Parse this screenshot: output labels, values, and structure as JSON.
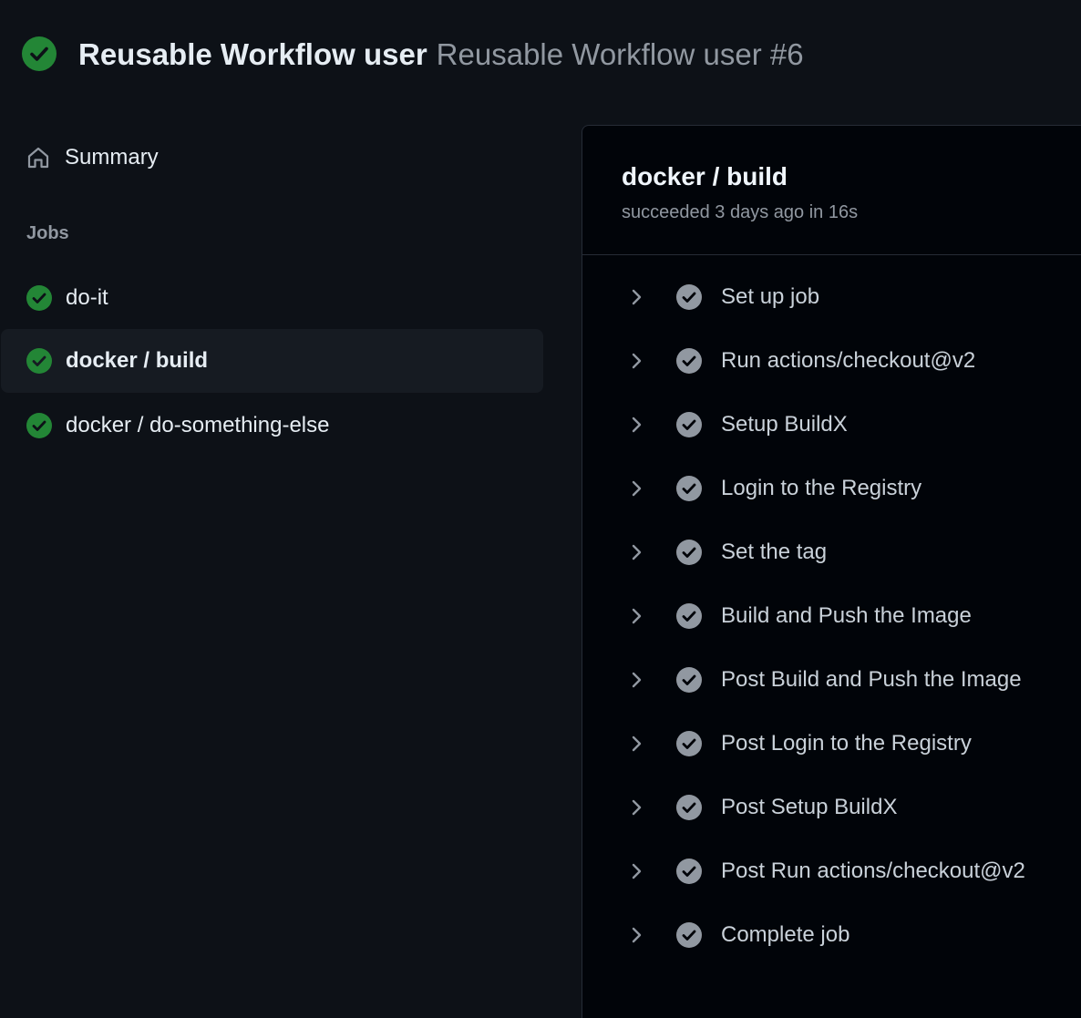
{
  "header": {
    "workflow_name": "Reusable Workflow user",
    "run_title": "Reusable Workflow user #6",
    "status": "success"
  },
  "sidebar": {
    "summary_label": "Summary",
    "jobs_heading": "Jobs",
    "jobs": [
      {
        "label": "do-it",
        "status": "success",
        "selected": false
      },
      {
        "label": "docker / build",
        "status": "success",
        "selected": true
      },
      {
        "label": "docker / do-something-else",
        "status": "success",
        "selected": false
      }
    ]
  },
  "job_panel": {
    "title": "docker / build",
    "meta": "succeeded 3 days ago in 16s",
    "steps": [
      {
        "label": "Set up job"
      },
      {
        "label": "Run actions/checkout@v2"
      },
      {
        "label": "Setup BuildX"
      },
      {
        "label": "Login to the Registry"
      },
      {
        "label": "Set the tag"
      },
      {
        "label": "Build and Push the Image"
      },
      {
        "label": "Post Build and Push the Image"
      },
      {
        "label": "Post Login to the Registry"
      },
      {
        "label": "Post Setup BuildX"
      },
      {
        "label": "Post Run actions/checkout@v2"
      },
      {
        "label": "Complete job"
      }
    ]
  },
  "colors": {
    "success_green": "#238636",
    "step_check_gray": "#9198a1",
    "background": "#0d1117",
    "panel_background": "#010409"
  }
}
